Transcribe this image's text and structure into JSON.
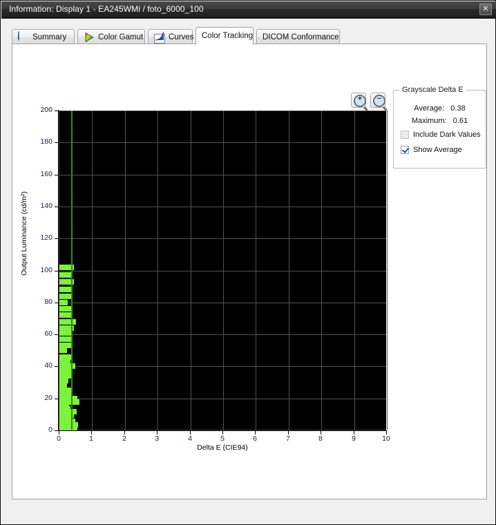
{
  "window": {
    "title": "Information: Display 1 - EA245WMi / foto_6000_100",
    "close_label": "✕"
  },
  "tabs": [
    {
      "label": "Summary",
      "icon": "info-icon",
      "active": false
    },
    {
      "label": "Color Gamut",
      "icon": "gamut-triangle-icon",
      "active": false
    },
    {
      "label": "Curves",
      "icon": "curve-chart-icon",
      "active": false
    },
    {
      "label": "Color Tracking",
      "icon": "none",
      "active": true
    },
    {
      "label": "DICOM Conformance",
      "icon": "none",
      "active": false
    }
  ],
  "toolbar": {
    "zoom_in_label": "+",
    "zoom_out_label": "−",
    "zoom_in_name": "zoom-in-magnifier",
    "zoom_out_name": "zoom-out-magnifier"
  },
  "side_panel": {
    "legend": "Grayscale Delta E",
    "average_label": "Average:",
    "average_value": "0.38",
    "maximum_label": "Maximum:",
    "maximum_value": "0.61",
    "include_dark_values_label": "Include Dark Values",
    "include_dark_values_checked": false,
    "show_average_label": "Show Average",
    "show_average_checked": true
  },
  "colors": {
    "bar": "#7cf23c",
    "average_line": "#2f8f18",
    "plot_background": "#000000",
    "grid": "#555555",
    "tick_label": "#1a1a4a"
  },
  "chart_data": {
    "type": "bar",
    "orientation": "horizontal",
    "title": "",
    "xlabel": "Delta E (CIE94)",
    "ylabel": "Output Luminance (cd/m²)",
    "xlim": [
      0,
      10
    ],
    "ylim": [
      0,
      200
    ],
    "xticks": [
      0,
      1,
      2,
      3,
      4,
      5,
      6,
      7,
      8,
      9,
      10
    ],
    "yticks": [
      0,
      20,
      40,
      60,
      80,
      100,
      120,
      140,
      160,
      180,
      200
    ],
    "grid": true,
    "legend": "none",
    "annotations": [
      {
        "name": "average-line",
        "type": "vline",
        "x": 0.38,
        "label": "Average Delta E"
      }
    ],
    "series": [
      {
        "name": "Grayscale Delta E",
        "color": "#7cf23c",
        "note": "Each bar: y = output luminance (cd/m²) of a grayscale patch, length = Delta E (CIE94)",
        "points": [
          {
            "luminance": 102.0,
            "delta_e": 0.45
          },
          {
            "luminance": 97.0,
            "delta_e": 0.4
          },
          {
            "luminance": 93.0,
            "delta_e": 0.44
          },
          {
            "luminance": 88.0,
            "delta_e": 0.36
          },
          {
            "luminance": 84.0,
            "delta_e": 0.41
          },
          {
            "luminance": 80.0,
            "delta_e": 0.25
          },
          {
            "luminance": 76.0,
            "delta_e": 0.36
          },
          {
            "luminance": 72.0,
            "delta_e": 0.38
          },
          {
            "luminance": 68.0,
            "delta_e": 0.5
          },
          {
            "luminance": 64.0,
            "delta_e": 0.44
          },
          {
            "luminance": 61.0,
            "delta_e": 0.39
          },
          {
            "luminance": 57.0,
            "delta_e": 0.41
          },
          {
            "luminance": 53.0,
            "delta_e": 0.36
          },
          {
            "luminance": 50.0,
            "delta_e": 0.23
          },
          {
            "luminance": 46.0,
            "delta_e": 0.35
          },
          {
            "luminance": 43.0,
            "delta_e": 0.33
          },
          {
            "luminance": 40.0,
            "delta_e": 0.48
          },
          {
            "luminance": 37.0,
            "delta_e": 0.39
          },
          {
            "luminance": 34.0,
            "delta_e": 0.36
          },
          {
            "luminance": 31.0,
            "delta_e": 0.27
          },
          {
            "luminance": 28.0,
            "delta_e": 0.24
          },
          {
            "luminance": 25.0,
            "delta_e": 0.36
          },
          {
            "luminance": 22.0,
            "delta_e": 0.4
          },
          {
            "luminance": 20.0,
            "delta_e": 0.55
          },
          {
            "luminance": 17.5,
            "delta_e": 0.61
          },
          {
            "luminance": 15.5,
            "delta_e": 0.3
          },
          {
            "luminance": 13.5,
            "delta_e": 0.33
          },
          {
            "luminance": 11.5,
            "delta_e": 0.52
          },
          {
            "luminance": 9.5,
            "delta_e": 0.44
          },
          {
            "luminance": 7.5,
            "delta_e": 0.39
          },
          {
            "luminance": 5.5,
            "delta_e": 0.48
          },
          {
            "luminance": 3.5,
            "delta_e": 0.57
          },
          {
            "luminance": 1.5,
            "delta_e": 0.54
          }
        ]
      }
    ]
  }
}
